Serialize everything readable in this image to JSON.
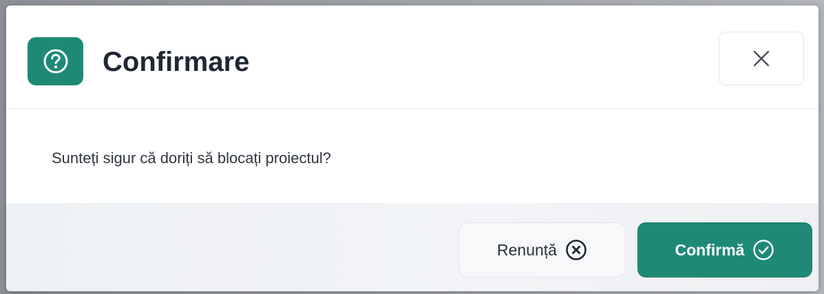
{
  "dialog": {
    "title": "Confirmare",
    "header_icon": "question-circle-icon",
    "close_icon": "close-icon",
    "message": "Sunteți sigur că doriți să blocați proiectul?",
    "cancel": {
      "label": "Renunță",
      "icon": "x-circle-icon"
    },
    "confirm": {
      "label": "Confirmă",
      "icon": "check-circle-icon"
    }
  },
  "colors": {
    "accent": "#1e8a76",
    "title_text": "#1f2733",
    "body_text": "#2f3640",
    "footer_bg": "#eef1f4"
  }
}
